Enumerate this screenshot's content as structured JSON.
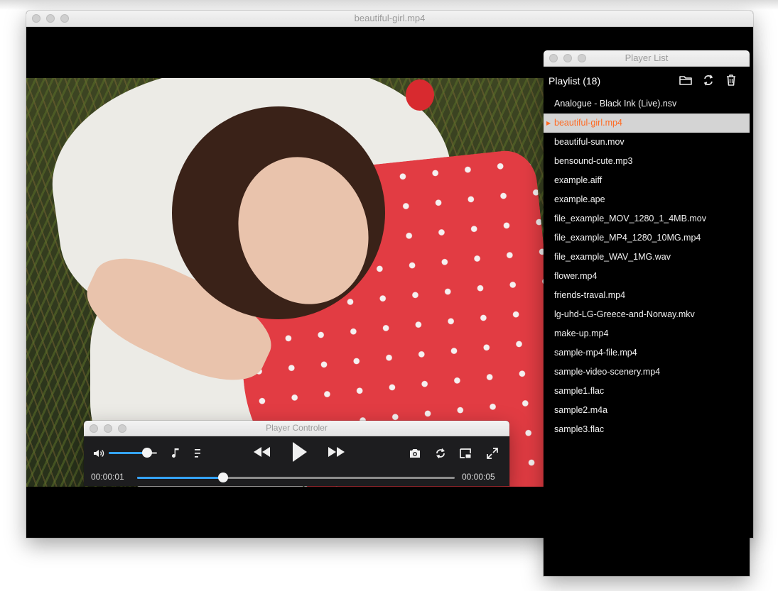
{
  "main_window": {
    "title": "beautiful-girl.mp4"
  },
  "playlist_window": {
    "title": "Player List",
    "heading": "Playlist (18)",
    "tools": [
      "open-folder-icon",
      "repeat-icon",
      "trash-icon"
    ],
    "items": [
      "Analogue - Black Ink (Live).nsv",
      "beautiful-girl.mp4",
      "beautiful-sun.mov",
      "bensound-cute.mp3",
      "example.aiff",
      "example.ape",
      "file_example_MOV_1280_1_4MB.mov",
      "file_example_MP4_1280_10MG.mp4",
      "file_example_WAV_1MG.wav",
      "flower.mp4",
      "friends-traval.mp4",
      "lg-uhd-LG-Greece-and-Norway.mkv",
      "make-up.mp4",
      "sample-mp4-file.mp4",
      "sample-video-scenery.mp4",
      "sample1.flac",
      "sample2.m4a",
      "sample3.flac"
    ],
    "active_index": 1
  },
  "controller_window": {
    "title": "Player Controler",
    "volume_level": 0.8,
    "current_time": "00:00:01",
    "total_time": "00:00:05",
    "progress": 0.27
  },
  "colors": {
    "accent": "#35a3ff",
    "active_item_text": "#ff6a22",
    "active_item_bg": "#d4d4d4"
  }
}
